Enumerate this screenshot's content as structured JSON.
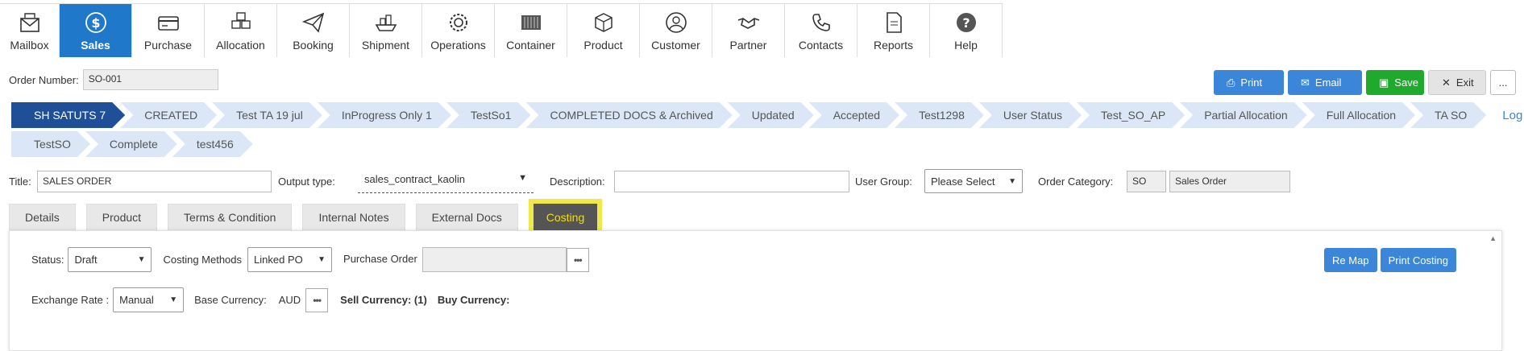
{
  "nav": [
    {
      "label": "Mailbox",
      "icon": "mailbox-icon"
    },
    {
      "label": "Sales",
      "icon": "dollar-icon",
      "active": true
    },
    {
      "label": "Purchase",
      "icon": "credit-card-icon"
    },
    {
      "label": "Allocation",
      "icon": "boxes-icon"
    },
    {
      "label": "Booking",
      "icon": "paper-plane-icon"
    },
    {
      "label": "Shipment",
      "icon": "ship-icon"
    },
    {
      "label": "Operations",
      "icon": "gears-icon"
    },
    {
      "label": "Container",
      "icon": "container-icon"
    },
    {
      "label": "Product",
      "icon": "cube-icon"
    },
    {
      "label": "Customer",
      "icon": "user-icon"
    },
    {
      "label": "Partner",
      "icon": "handshake-icon"
    },
    {
      "label": "Contacts",
      "icon": "phone-icon"
    },
    {
      "label": "Reports",
      "icon": "document-icon"
    },
    {
      "label": "Help",
      "icon": "help-icon"
    }
  ],
  "order": {
    "label": "Order Number:",
    "value": "SO-001"
  },
  "actions": {
    "print": "Print",
    "email": "Email",
    "save": "Save",
    "exit": "Exit",
    "more": "..."
  },
  "statuses_row1": [
    "SH SATUTS 7",
    "CREATED",
    "Test TA 19 jul",
    "InProgress Only 1",
    "TestSo1",
    "COMPLETED DOCS & Archived",
    "Updated",
    "Accepted",
    "Test1298",
    "User Status",
    "Test_SO_AP",
    "Partial Allocation",
    "Full Allocation",
    "TA SO"
  ],
  "statuses_row2": [
    "TestSO",
    "Complete",
    "test456"
  ],
  "log_link": "Log",
  "form": {
    "title_label": "Title:",
    "title_value": "SALES ORDER",
    "output_label": "Output type:",
    "output_value": "sales_contract_kaolin",
    "desc_label": "Description:",
    "desc_value": "",
    "usergroup_label": "User Group:",
    "usergroup_value": "Please Select",
    "category_label": "Order Category:",
    "category_code": "SO",
    "category_name": "Sales Order"
  },
  "tabs": [
    "Details",
    "Product",
    "Terms & Condition",
    "Internal Notes",
    "External Docs",
    "Costing"
  ],
  "costing": {
    "status_label": "Status:",
    "status_value": "Draft",
    "method_label": "Costing Methods",
    "method_value": "Linked PO",
    "po_label": "Purchase Order",
    "po_value": "",
    "remap": "Re Map",
    "print_costing": "Print Costing",
    "rate_label": "Exchange Rate :",
    "rate_value": "Manual",
    "base_label": "Base Currency:",
    "base_value": "AUD",
    "sell_label": "Sell Currency: (1)",
    "buy_label": "Buy Currency:"
  },
  "colors": {
    "primary": "#1f78c9",
    "active_status": "#1f4f96",
    "status_bg": "#dbe7f6",
    "save": "#1faa2e",
    "highlight": "#f0e84a"
  }
}
